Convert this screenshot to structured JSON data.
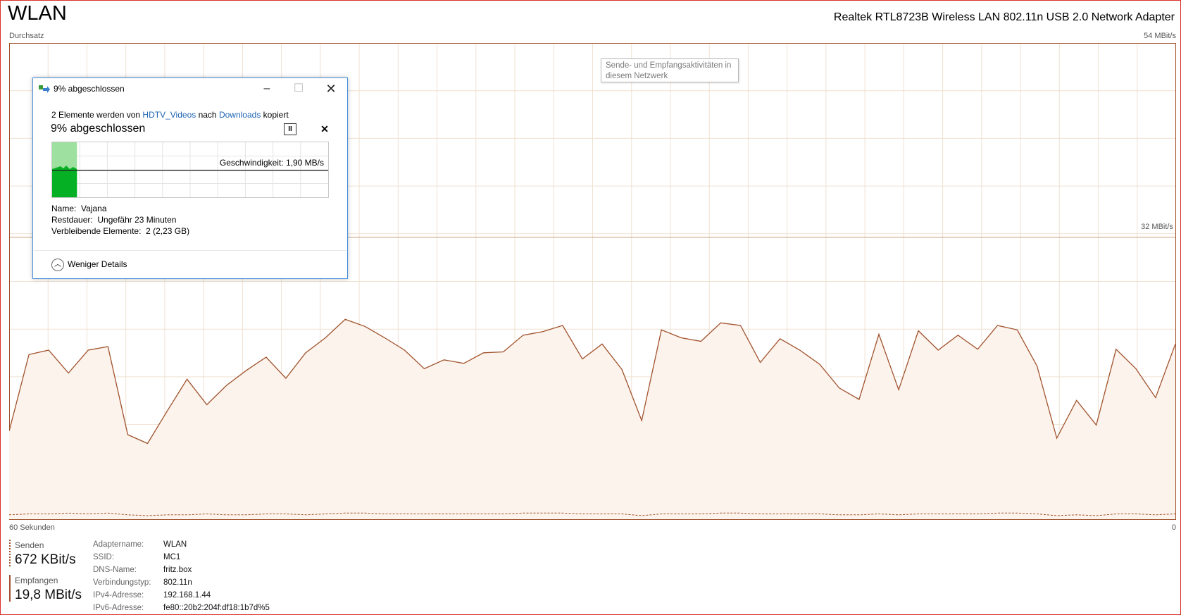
{
  "window": {
    "title": "WLAN",
    "adapter": "Realtek RTL8723B Wireless LAN 802.11n USB 2.0 Network Adapter"
  },
  "graph": {
    "throughput_label": "Durchsatz",
    "max_label": "54 MBit/s",
    "mid_label": "32 MBit/s",
    "time_label": "60 Sekunden",
    "zero_label": "0",
    "tooltip": "Sende- und Empfangsaktivitäten in diesem Netzwerk",
    "line_color": "#a0522d",
    "fill_color": "#fcf3ec",
    "grid_color": "#f0e1d2"
  },
  "chart_data": {
    "type": "area",
    "title": "Durchsatz",
    "ylim": [
      0,
      54
    ],
    "y_unit": "MBit/s",
    "xlabel": "60 Sekunden",
    "series": [
      {
        "name": "Empfangen",
        "values": [
          10,
          18.7,
          19.2,
          16.6,
          19.2,
          19.6,
          9.6,
          8.6,
          12.3,
          15.9,
          13.0,
          15.2,
          16.9,
          18.4,
          16.0,
          18.9,
          20.6,
          22.7,
          21.9,
          20.6,
          19.2,
          17.1,
          18.1,
          17.7,
          18.9,
          19.0,
          20.9,
          21.3,
          22.0,
          18.2,
          19.9,
          17.0,
          11.2,
          21.5,
          20.6,
          20.2,
          22.3,
          22.0,
          17.8,
          20.5,
          19.2,
          17.6,
          14.9,
          13.6,
          21.0,
          14.7,
          21.4,
          19.2,
          20.9,
          19.3,
          22.0,
          21.5,
          17.4,
          9.2,
          13.5,
          10.7,
          19.3,
          17.1,
          13.8,
          19.9
        ]
      },
      {
        "name": "Senden",
        "values": [
          0.5,
          0.6,
          0.6,
          0.7,
          0.6,
          0.7,
          0.5,
          0.4,
          0.5,
          0.5,
          0.6,
          0.5,
          0.5,
          0.6,
          0.6,
          0.5,
          0.6,
          0.7,
          0.7,
          0.6,
          0.6,
          0.6,
          0.6,
          0.6,
          0.6,
          0.6,
          0.7,
          0.7,
          0.7,
          0.6,
          0.6,
          0.6,
          0.4,
          0.6,
          0.6,
          0.6,
          0.7,
          0.7,
          0.6,
          0.6,
          0.6,
          0.6,
          0.5,
          0.5,
          0.6,
          0.5,
          0.6,
          0.6,
          0.6,
          0.6,
          0.7,
          0.7,
          0.6,
          0.4,
          0.5,
          0.4,
          0.6,
          0.6,
          0.5,
          0.6
        ]
      }
    ]
  },
  "dialog": {
    "title": "9% abgeschlossen",
    "line_prefix": "2 Elemente werden von ",
    "source": "HDTV_Videos",
    "line_mid": " nach ",
    "destination": "Downloads",
    "line_suffix": " kopiert",
    "percent_label": "9% abgeschlossen",
    "progress": 0.09,
    "speed_text": "Geschwindigkeit: 1,90 MB/s",
    "name_key": "Name:",
    "name_val": "Vajana",
    "rest_key": "Restdauer:",
    "rest_val": "Ungefähr 23 Minuten",
    "remaining_key": "Verbleibende Elemente:",
    "remaining_val": "2 (2,23 GB)",
    "less_details": "Weniger Details",
    "progress_color": "#06b025",
    "progress_light": "#9de0a0"
  },
  "stats": {
    "send_label": "Senden",
    "send_value": "672 KBit/s",
    "recv_label": "Empfangen",
    "recv_value": "19,8 MBit/s",
    "props": [
      {
        "key": "Adaptername:",
        "val": "WLAN"
      },
      {
        "key": "SSID:",
        "val": "MC1"
      },
      {
        "key": "DNS-Name:",
        "val": "fritz.box"
      },
      {
        "key": "Verbindungstyp:",
        "val": "802.11n"
      },
      {
        "key": "IPv4-Adresse:",
        "val": "192.168.1.44"
      },
      {
        "key": "IPv6-Adresse:",
        "val": "fe80::20b2:204f:df18:1b7d%5"
      }
    ]
  }
}
